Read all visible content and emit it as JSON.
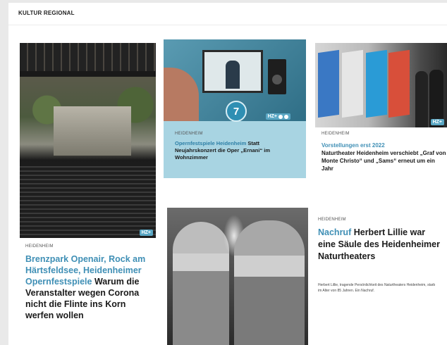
{
  "section": {
    "title": "KULTUR REGIONAL"
  },
  "colors": {
    "accent": "#3f8fb5",
    "badge": "#5aa7c4",
    "highlight_card": "#a8d4e2"
  },
  "articles": [
    {
      "dateline": "HEIDENHEIM",
      "kicker": "Brenzpark Openair, Rock am Härtsfeldsee, Heidenheimer Opernfestspiele",
      "title": "Warum die Veranstalter wegen Corona nicht die Flinte ins Korn werfen wollen",
      "badge": "HZ+"
    },
    {
      "dateline": "HEIDENHEIM",
      "kicker": "Opernfestspiele Heidenheim",
      "title": "Statt Neujahrskonzert die Oper „Ernani“ im Wohnzimmer",
      "badge": "HZ+",
      "marker": "7"
    },
    {
      "dateline": "HEIDENHEIM",
      "kicker": "Vorstellungen erst 2022",
      "title": "Naturtheater Heidenheim verschiebt „Graf von Monte Christo“ und „Sams“ erneut um ein Jahr",
      "badge": "HZ+"
    },
    {
      "dateline": "HEIDENHEIM",
      "kicker": "Nachruf",
      "title": "Herbert Lillie war eine Säule des Heidenheimer Naturtheaters",
      "teaser": "Herbert Lillie, tragende Persönlichkeit des Naturtheaters Heidenheim, starb im Alter von 85 Jahren. Ein Nachruf."
    }
  ]
}
